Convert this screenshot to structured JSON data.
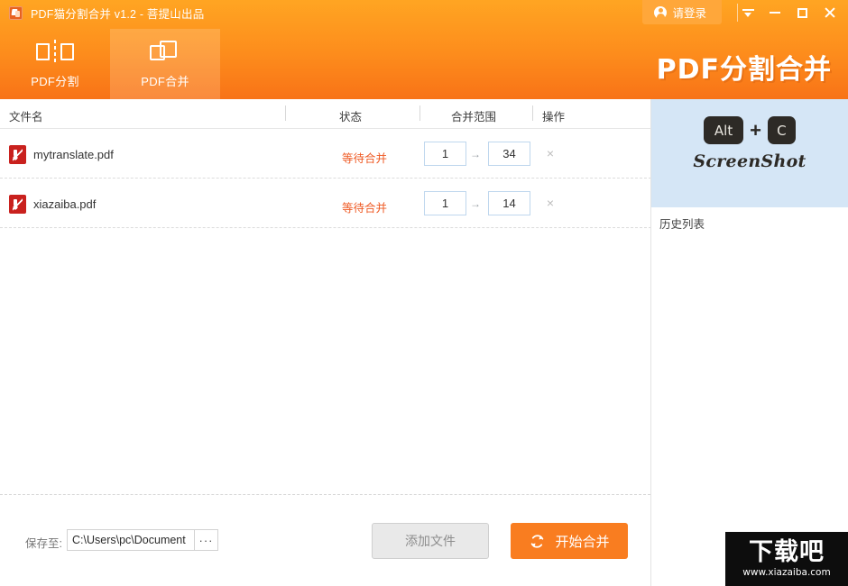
{
  "window": {
    "title": "PDF猫分割合并 v1.2 - 菩提山出品",
    "app_icon": "app-logo-icon",
    "login_label": "请登录",
    "controls": {
      "collapse": "collapse-icon",
      "minimize": "minimize-icon",
      "maximize": "maximize-icon",
      "close": "close-icon"
    }
  },
  "tabs": [
    {
      "label": "PDF分割",
      "icon": "split-icon",
      "active": false
    },
    {
      "label": "PDF合并",
      "icon": "merge-icon",
      "active": true
    }
  ],
  "banner": {
    "title": "PDF分割合并"
  },
  "table": {
    "headers": [
      "文件名",
      "状态",
      "合并范围",
      "操作"
    ],
    "rows": [
      {
        "filename": "mytranslate.pdf",
        "icon": "pdf-file-icon",
        "status": "等待合并",
        "range_from": "1",
        "range_arrow": "→",
        "range_to": "34",
        "delete": "×"
      },
      {
        "filename": "xiazaiba.pdf",
        "icon": "pdf-file-icon",
        "status": "等待合并",
        "range_from": "1",
        "range_arrow": "→",
        "range_to": "14",
        "delete": "×"
      }
    ]
  },
  "ad": {
    "key_alt": "Alt",
    "plus": "+",
    "key_c": "C",
    "caption": "ScreenShot"
  },
  "history": {
    "label": "历史列表"
  },
  "footer": {
    "save_label": "保存至:",
    "save_path": "C:\\Users\\pc\\Document",
    "save_path_placeholder": "C:\\Users\\pc\\Document",
    "browse_label": "···",
    "add_files_label": "添加文件",
    "start_merge_label": "开始合并",
    "start_merge_icon": "refresh-icon"
  },
  "watermark": {
    "logo_text": "下载吧",
    "site": "www.xiazaiba.com"
  },
  "colors": {
    "header_top": "#FFA522",
    "header_bottom": "#F87317",
    "accent_orange": "#F97D20",
    "status_text": "#EF5A24",
    "pdf_red": "#C9211E",
    "ad_background": "#D5E6F6",
    "input_border": "#BFD7EE"
  }
}
